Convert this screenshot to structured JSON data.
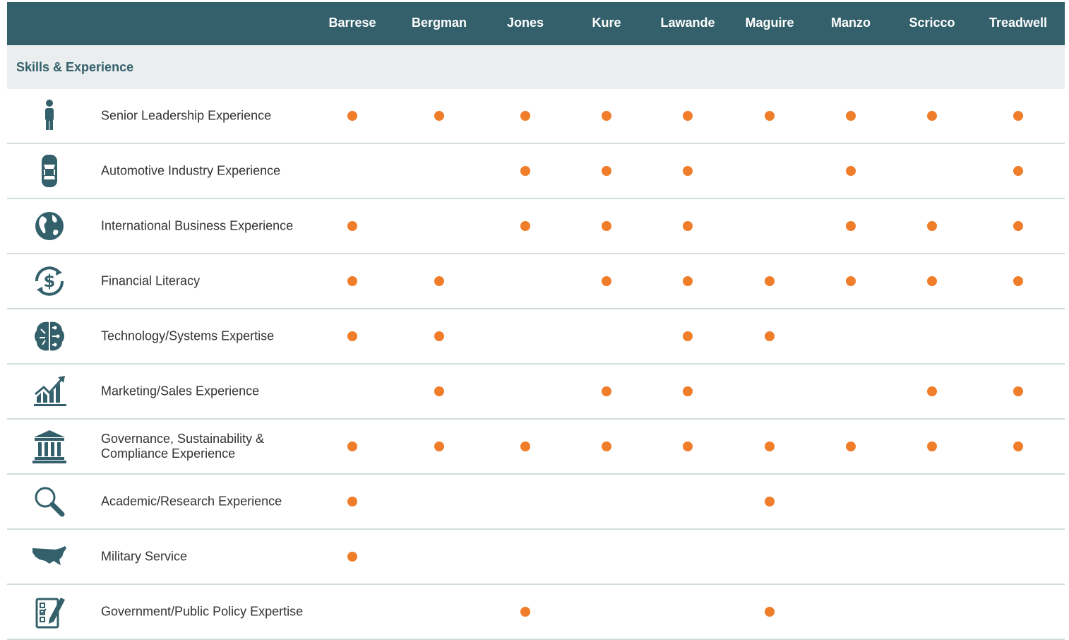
{
  "header": {
    "columns": [
      "Barrese",
      "Bergman",
      "Jones",
      "Kure",
      "Lawande",
      "Maguire",
      "Manzo",
      "Scricco",
      "Treadwell"
    ]
  },
  "section": {
    "title": "Skills & Experience"
  },
  "colors": {
    "header_bg": "#33606b",
    "section_bg": "#ebeeee",
    "dot": "#f07d2a",
    "icon": "#33606b"
  },
  "rows": [
    {
      "label": "Senior Leadership Experience",
      "icon": "person-icon",
      "marks": [
        1,
        1,
        1,
        1,
        1,
        1,
        1,
        1,
        1
      ]
    },
    {
      "label": "Automotive Industry Experience",
      "icon": "car-icon",
      "marks": [
        0,
        0,
        1,
        1,
        1,
        0,
        1,
        0,
        1
      ]
    },
    {
      "label": "International Business Experience",
      "icon": "globe-icon",
      "marks": [
        1,
        0,
        1,
        1,
        1,
        0,
        1,
        1,
        1
      ]
    },
    {
      "label": "Financial Literacy",
      "icon": "dollar-cycle-icon",
      "marks": [
        1,
        1,
        0,
        1,
        1,
        1,
        1,
        1,
        1
      ]
    },
    {
      "label": "Technology/Systems Expertise",
      "icon": "brain-circuit-icon",
      "marks": [
        1,
        1,
        0,
        0,
        1,
        1,
        0,
        0,
        0
      ]
    },
    {
      "label": "Marketing/Sales Experience",
      "icon": "growth-chart-icon",
      "marks": [
        0,
        1,
        0,
        1,
        1,
        0,
        0,
        1,
        1
      ]
    },
    {
      "label": "Governance, Sustainability & Compliance Experience",
      "icon": "institution-icon",
      "marks": [
        1,
        1,
        1,
        1,
        1,
        1,
        1,
        1,
        1
      ]
    },
    {
      "label": "Academic/Research Experience",
      "icon": "magnifier-icon",
      "marks": [
        1,
        0,
        0,
        0,
        0,
        1,
        0,
        0,
        0
      ]
    },
    {
      "label": "Military Service",
      "icon": "us-map-icon",
      "marks": [
        1,
        0,
        0,
        0,
        0,
        0,
        0,
        0,
        0
      ]
    },
    {
      "label": "Government/Public Policy Expertise",
      "icon": "checklist-pen-icon",
      "marks": [
        0,
        0,
        1,
        0,
        0,
        1,
        0,
        0,
        0
      ]
    }
  ]
}
